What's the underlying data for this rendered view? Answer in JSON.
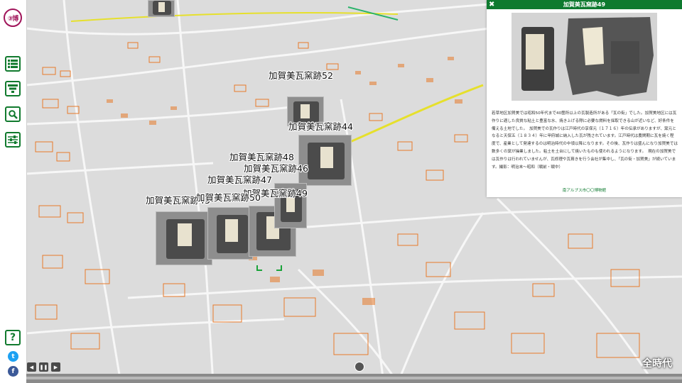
{
  "app": {
    "logo_text": "③博"
  },
  "toolbar": {
    "buttons": [
      {
        "name": "list-button",
        "icon": "list-icon"
      },
      {
        "name": "filter-button",
        "icon": "filter-icon"
      },
      {
        "name": "search-button",
        "icon": "search-icon"
      },
      {
        "name": "settings-button",
        "icon": "sliders-icon"
      }
    ],
    "help_label": "?",
    "twitter_label": "t",
    "facebook_label": "f"
  },
  "panel": {
    "title": "加賀美瓦窯跡49",
    "close_label": "✖",
    "description": "若草地区加賀美では昭和50年代まで40箇所以上の瓦製造所がある「瓦の街」でした。加賀美地区には瓦作りに適した良質な粘土と豊富な水、焼き上げる際に必要な燃料を採取できる山が近いなど、好条件を備える土地でした。　加賀美での瓦作りは江戸時代の享保元（１７１６）年の伝承がありますが、窯元となると天保五（１８３４）年に甲府城に納入した瓦が残されています。江戸時代は農閑期に瓦を焼く程度で、産業として発達するのは明治時代の中頃以降になります。その後、瓦作りは盛んになり加賀美では数多くの窯が操業しました。粘土を土台にして焼いたものも使われるようになります。　現在の加賀美では瓦作りは行われていませんが、瓦修理や瓦葺きを行う会社が集中し、「瓦の街・加賀美」が続いています。撮影：明治末～昭和（戦前・戦中）",
    "credit": "南アルプス市〇〇博物館"
  },
  "markers": [
    {
      "label": "加賀美瓦窯跡52"
    },
    {
      "label": "加賀美瓦窯跡44"
    },
    {
      "label": "加賀美瓦窯跡48"
    },
    {
      "label": "加賀美瓦窯跡46"
    },
    {
      "label": "加賀美瓦窯跡47"
    },
    {
      "label": "加賀美瓦窯跡49"
    },
    {
      "label": "加賀美瓦窯跡45"
    },
    {
      "label": "加賀美瓦窯跡50"
    }
  ],
  "timeline": {
    "prev_label": "◀",
    "pause_label": "❚❚",
    "next_label": "▶",
    "era_label": "全時代"
  },
  "colors": {
    "accent": "#0e7a2f",
    "brand": "#a0145a",
    "map_background": "#d9d9d9",
    "building": "#e87a2a",
    "road_main": "#e6e02c"
  }
}
